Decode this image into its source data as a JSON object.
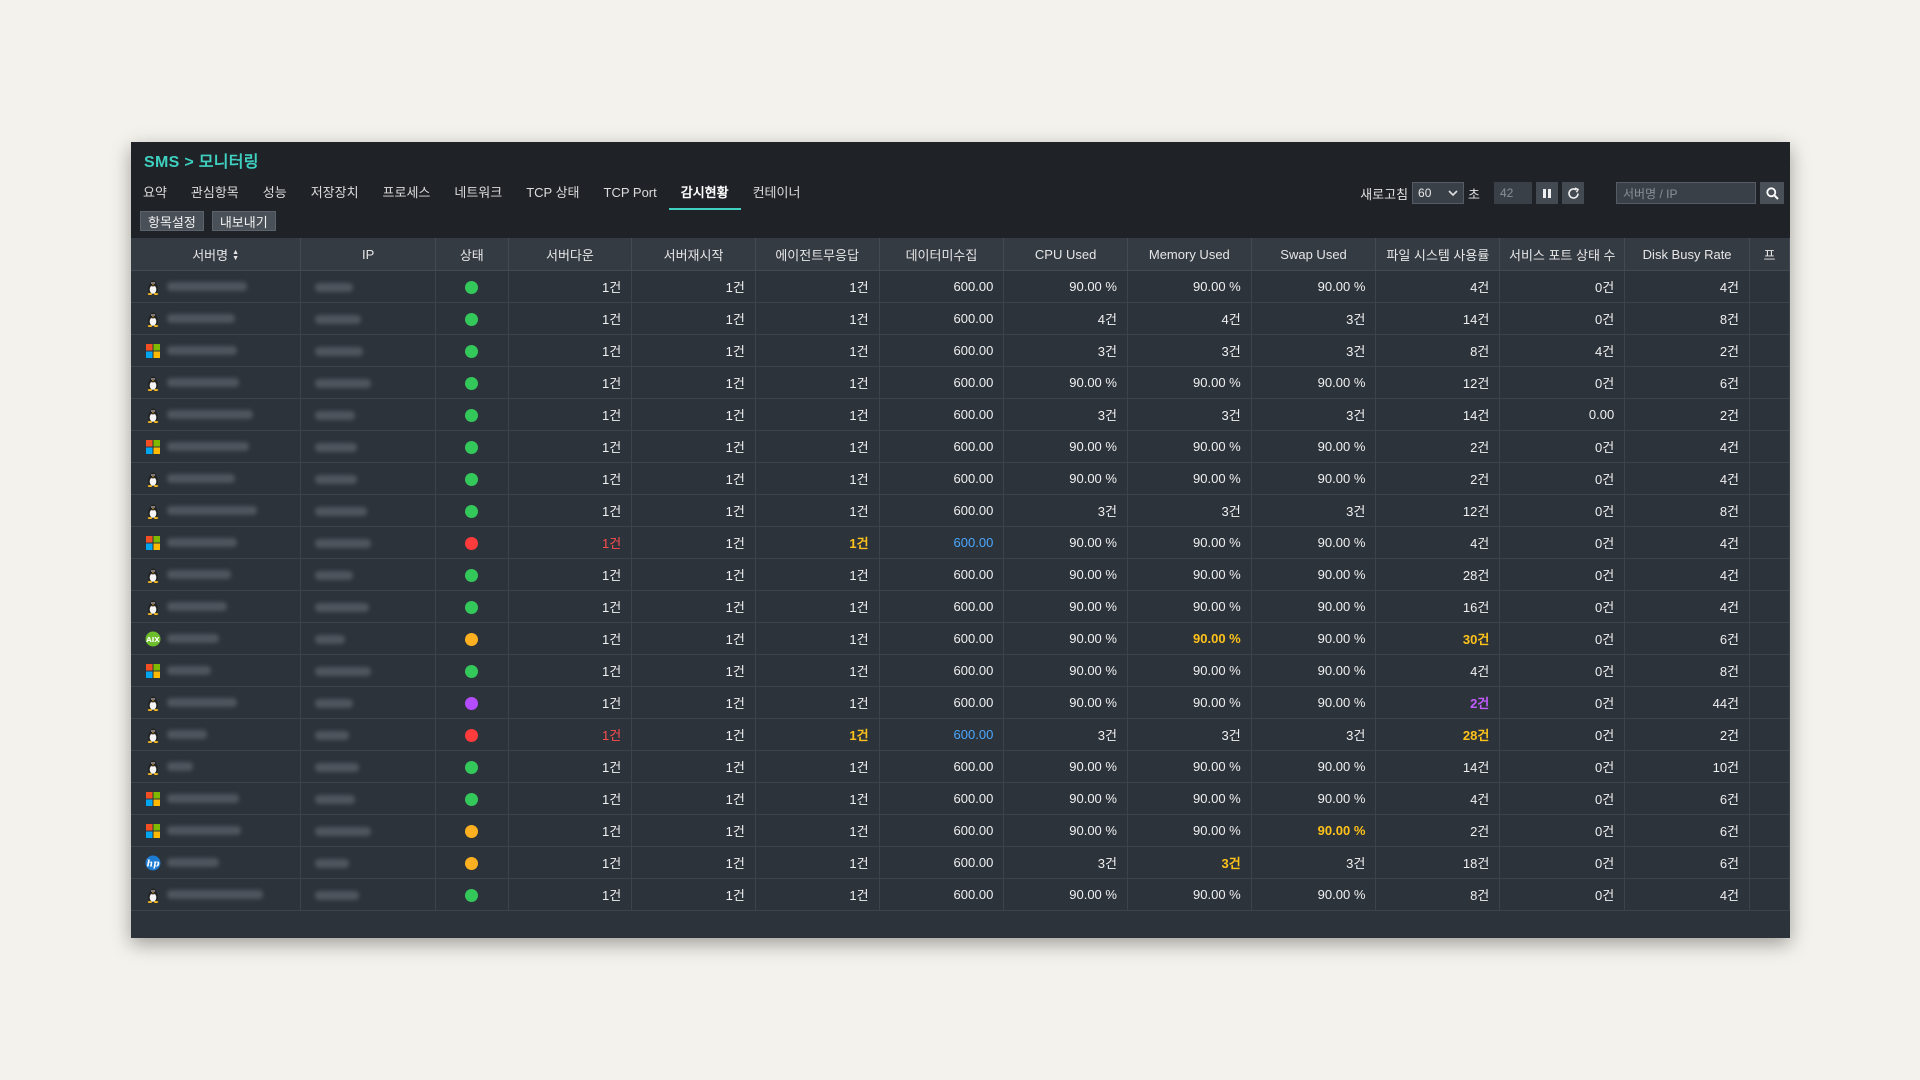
{
  "header": {
    "breadcrumb": "SMS > 모니터링",
    "tabs": [
      {
        "label": "요약",
        "active": false
      },
      {
        "label": "관심항목",
        "active": false
      },
      {
        "label": "성능",
        "active": false
      },
      {
        "label": "저장장치",
        "active": false
      },
      {
        "label": "프로세스",
        "active": false
      },
      {
        "label": "네트워크",
        "active": false
      },
      {
        "label": "TCP 상태",
        "active": false
      },
      {
        "label": "TCP Port",
        "active": false
      },
      {
        "label": "감시현황",
        "active": true
      },
      {
        "label": "컨테이너",
        "active": false
      }
    ],
    "buttons": {
      "settings": "항목설정",
      "export": "내보내기"
    },
    "refresh": {
      "label": "새로고침",
      "interval": "60",
      "unit": "초",
      "countdown": "42"
    },
    "search": {
      "placeholder": "서버명 / IP"
    }
  },
  "table": {
    "columns": [
      "서버명",
      "IP",
      "상태",
      "서버다운",
      "서버재시작",
      "에이전트무응답",
      "데이터미수집",
      "CPU Used",
      "Memory Used",
      "Swap Used",
      "파일 시스템 사용률",
      "서비스 포트 상태 수",
      "Disk Busy Rate",
      "프"
    ],
    "sort_indicator": "▲▼",
    "status_colors": {
      "green": "#34c759",
      "red": "#ff3b3b",
      "orange": "#ffb020",
      "purple": "#b44dff"
    },
    "rows": [
      {
        "os": "linux",
        "status": "green",
        "down": "1건",
        "restart": "1건",
        "agent": "1건",
        "nodata": "600.00",
        "cpu": "90.00 %",
        "mem": "90.00 %",
        "swap": "90.00 %",
        "fs": "4건",
        "port": "0건",
        "disk": "4건"
      },
      {
        "os": "linux",
        "status": "green",
        "down": "1건",
        "restart": "1건",
        "agent": "1건",
        "nodata": "600.00",
        "cpu": "4건",
        "mem": "4건",
        "swap": "3건",
        "fs": "14건",
        "port": "0건",
        "disk": "8건"
      },
      {
        "os": "windows",
        "status": "green",
        "down": "1건",
        "restart": "1건",
        "agent": "1건",
        "nodata": "600.00",
        "cpu": "3건",
        "mem": "3건",
        "swap": "3건",
        "fs": "8건",
        "port": "4건",
        "disk": "2건"
      },
      {
        "os": "linux",
        "status": "green",
        "down": "1건",
        "restart": "1건",
        "agent": "1건",
        "nodata": "600.00",
        "cpu": "90.00 %",
        "mem": "90.00 %",
        "swap": "90.00 %",
        "fs": "12건",
        "port": "0건",
        "disk": "6건"
      },
      {
        "os": "linux",
        "status": "green",
        "down": "1건",
        "restart": "1건",
        "agent": "1건",
        "nodata": "600.00",
        "cpu": "3건",
        "mem": "3건",
        "swap": "3건",
        "fs": "14건",
        "port": "0.00",
        "disk": "2건"
      },
      {
        "os": "windows",
        "status": "green",
        "down": "1건",
        "restart": "1건",
        "agent": "1건",
        "nodata": "600.00",
        "cpu": "90.00 %",
        "mem": "90.00 %",
        "swap": "90.00 %",
        "fs": "2건",
        "port": "0건",
        "disk": "4건"
      },
      {
        "os": "linux",
        "status": "green",
        "down": "1건",
        "restart": "1건",
        "agent": "1건",
        "nodata": "600.00",
        "cpu": "90.00 %",
        "mem": "90.00 %",
        "swap": "90.00 %",
        "fs": "2건",
        "port": "0건",
        "disk": "4건"
      },
      {
        "os": "linux",
        "status": "green",
        "down": "1건",
        "restart": "1건",
        "agent": "1건",
        "nodata": "600.00",
        "cpu": "3건",
        "mem": "3건",
        "swap": "3건",
        "fs": "12건",
        "port": "0건",
        "disk": "8건"
      },
      {
        "os": "windows",
        "status": "red",
        "down": "1건",
        "restart": "1건",
        "agent": "1건",
        "nodata": "600.00",
        "cpu": "90.00 %",
        "mem": "90.00 %",
        "swap": "90.00 %",
        "fs": "4건",
        "port": "0건",
        "disk": "4건",
        "hl": {
          "down": "red",
          "agent": "yel",
          "nodata": "blu"
        }
      },
      {
        "os": "linux",
        "status": "green",
        "down": "1건",
        "restart": "1건",
        "agent": "1건",
        "nodata": "600.00",
        "cpu": "90.00 %",
        "mem": "90.00 %",
        "swap": "90.00 %",
        "fs": "28건",
        "port": "0건",
        "disk": "4건"
      },
      {
        "os": "linux",
        "status": "green",
        "down": "1건",
        "restart": "1건",
        "agent": "1건",
        "nodata": "600.00",
        "cpu": "90.00 %",
        "mem": "90.00 %",
        "swap": "90.00 %",
        "fs": "16건",
        "port": "0건",
        "disk": "4건"
      },
      {
        "os": "aix",
        "status": "orange",
        "down": "1건",
        "restart": "1건",
        "agent": "1건",
        "nodata": "600.00",
        "cpu": "90.00 %",
        "mem": "90.00 %",
        "swap": "90.00 %",
        "fs": "30건",
        "port": "0건",
        "disk": "6건",
        "hl": {
          "mem": "yel",
          "fs": "yel"
        }
      },
      {
        "os": "windows",
        "status": "green",
        "down": "1건",
        "restart": "1건",
        "agent": "1건",
        "nodata": "600.00",
        "cpu": "90.00 %",
        "mem": "90.00 %",
        "swap": "90.00 %",
        "fs": "4건",
        "port": "0건",
        "disk": "8건"
      },
      {
        "os": "linux",
        "status": "purple",
        "down": "1건",
        "restart": "1건",
        "agent": "1건",
        "nodata": "600.00",
        "cpu": "90.00 %",
        "mem": "90.00 %",
        "swap": "90.00 %",
        "fs": "2건",
        "port": "0건",
        "disk": "44건",
        "hl": {
          "fs": "pur"
        }
      },
      {
        "os": "linux",
        "status": "red",
        "down": "1건",
        "restart": "1건",
        "agent": "1건",
        "nodata": "600.00",
        "cpu": "3건",
        "mem": "3건",
        "swap": "3건",
        "fs": "28건",
        "port": "0건",
        "disk": "2건",
        "hl": {
          "down": "red",
          "agent": "yel",
          "nodata": "blu",
          "fs": "yel"
        }
      },
      {
        "os": "linux",
        "status": "green",
        "down": "1건",
        "restart": "1건",
        "agent": "1건",
        "nodata": "600.00",
        "cpu": "90.00 %",
        "mem": "90.00 %",
        "swap": "90.00 %",
        "fs": "14건",
        "port": "0건",
        "disk": "10건"
      },
      {
        "os": "windows",
        "status": "green",
        "down": "1건",
        "restart": "1건",
        "agent": "1건",
        "nodata": "600.00",
        "cpu": "90.00 %",
        "mem": "90.00 %",
        "swap": "90.00 %",
        "fs": "4건",
        "port": "0건",
        "disk": "6건"
      },
      {
        "os": "windows",
        "status": "orange",
        "down": "1건",
        "restart": "1건",
        "agent": "1건",
        "nodata": "600.00",
        "cpu": "90.00 %",
        "mem": "90.00 %",
        "swap": "90.00 %",
        "fs": "2건",
        "port": "0건",
        "disk": "6건",
        "hl": {
          "swap": "yel"
        }
      },
      {
        "os": "hp",
        "status": "orange",
        "down": "1건",
        "restart": "1건",
        "agent": "1건",
        "nodata": "600.00",
        "cpu": "3건",
        "mem": "3건",
        "swap": "3건",
        "fs": "18건",
        "port": "0건",
        "disk": "6건",
        "hl": {
          "mem": "yel"
        }
      },
      {
        "os": "linux",
        "status": "green",
        "down": "1건",
        "restart": "1건",
        "agent": "1건",
        "nodata": "600.00",
        "cpu": "90.00 %",
        "mem": "90.00 %",
        "swap": "90.00 %",
        "fs": "8건",
        "port": "0건",
        "disk": "4건"
      }
    ]
  }
}
